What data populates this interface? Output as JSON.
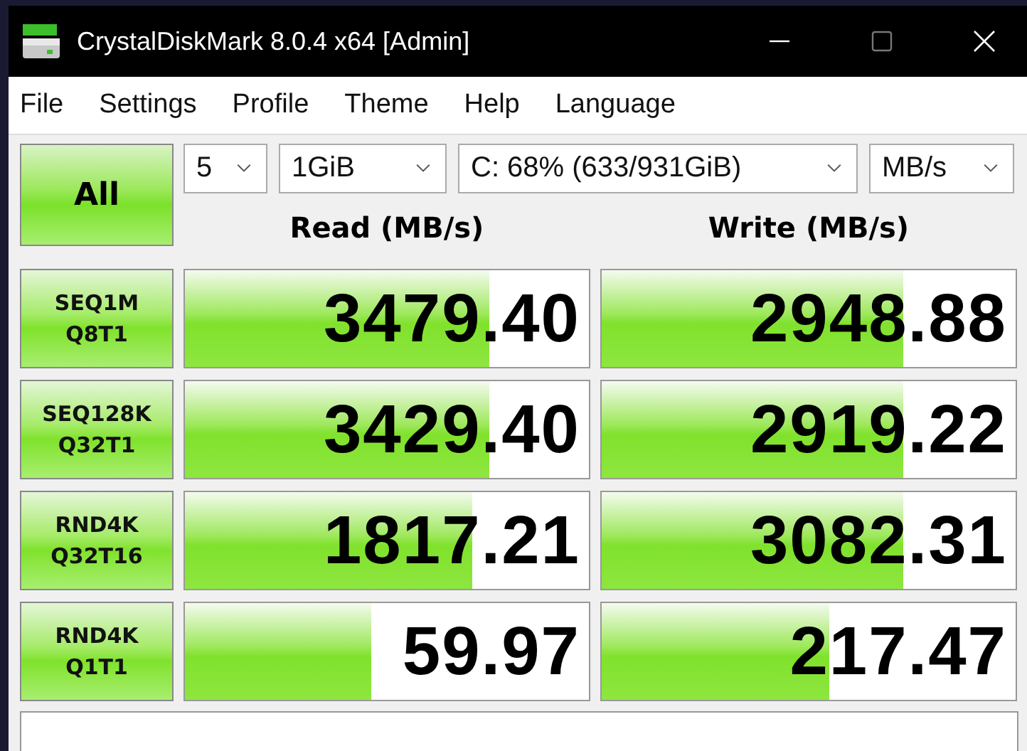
{
  "window": {
    "title": "CrystalDiskMark 8.0.4 x64 [Admin]"
  },
  "menu": [
    "File",
    "Settings",
    "Profile",
    "Theme",
    "Help",
    "Language"
  ],
  "all_button": "All",
  "settings": {
    "count": "5",
    "size": "1GiB",
    "drive": "C: 68% (633/931GiB)",
    "unit": "MB/s"
  },
  "columns": [
    "Read (MB/s)",
    "Write (MB/s)"
  ],
  "tests": [
    {
      "label": [
        "SEQ1M",
        "Q8T1"
      ],
      "read": {
        "value": "3479.40",
        "level": 0.755
      },
      "write": {
        "value": "2948.88",
        "level": 0.73
      }
    },
    {
      "label": [
        "SEQ128K",
        "Q32T1"
      ],
      "read": {
        "value": "3429.40",
        "level": 0.755
      },
      "write": {
        "value": "2919.22",
        "level": 0.73
      }
    },
    {
      "label": [
        "RND4K",
        "Q32T16"
      ],
      "read": {
        "value": "1817.21",
        "level": 0.71
      },
      "write": {
        "value": "3082.31",
        "level": 0.73
      }
    },
    {
      "label": [
        "RND4K",
        "Q1T1"
      ],
      "read": {
        "value": "59.97",
        "level": 0.46
      },
      "write": {
        "value": "217.47",
        "level": 0.55
      }
    }
  ]
}
